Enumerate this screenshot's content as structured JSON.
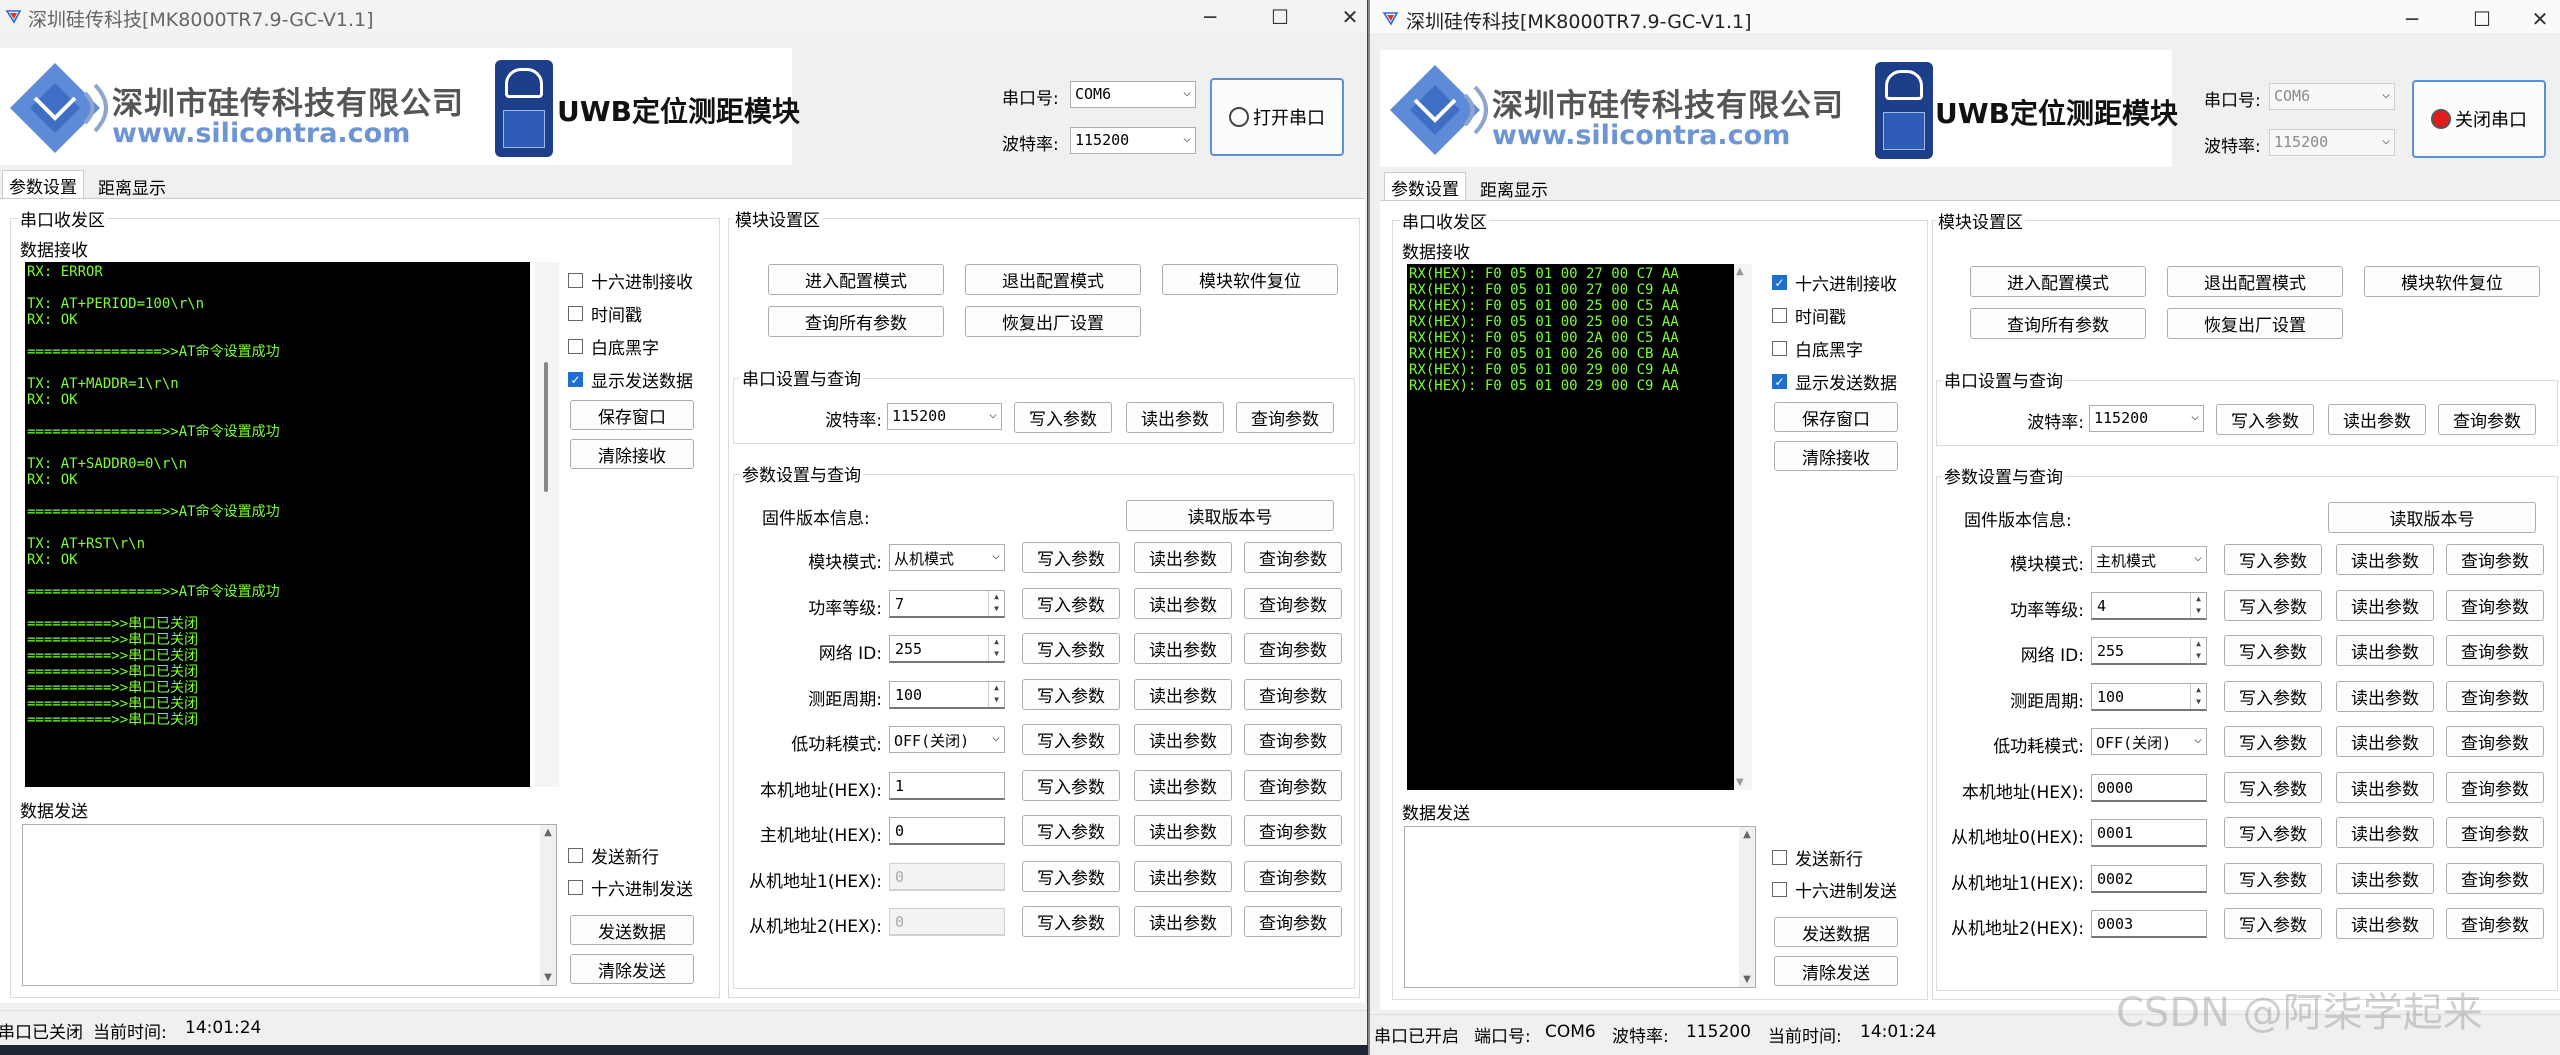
{
  "left": {
    "title": "深圳硅传科技[MK8000TR7.9-GC-V1.1]",
    "company": "深圳市硅传科技有限公司",
    "website": "www.silicontra.com",
    "product": "UWB定位测距模块",
    "port_label": "串口号:",
    "port_value": "COM6",
    "baud_label": "波特率:",
    "baud_value": "115200",
    "open_btn": "打开串口",
    "tabs": [
      "参数设置",
      "距离显示"
    ],
    "serial_group": "串口收发区",
    "recv_label": "数据接收",
    "term_lines": [
      "RX: ERROR",
      "",
      "TX: AT+PERIOD=100\\r\\n",
      "RX: OK",
      "",
      "================>>AT命令设置成功",
      "",
      "TX: AT+MADDR=1\\r\\n",
      "RX: OK",
      "",
      "================>>AT命令设置成功",
      "",
      "TX: AT+SADDR0=0\\r\\n",
      "RX: OK",
      "",
      "================>>AT命令设置成功",
      "",
      "TX: AT+RST\\r\\n",
      "RX: OK",
      "",
      "================>>AT命令设置成功",
      "",
      "==========>>串口已关闭",
      "==========>>串口已关闭",
      "==========>>串口已关闭",
      "==========>>串口已关闭",
      "==========>>串口已关闭",
      "==========>>串口已关闭",
      "==========>>串口已关闭"
    ],
    "chk_hex": "十六进制接收",
    "chk_time": "时间戳",
    "chk_white": "白底黑字",
    "chk_show": "显示发送数据",
    "save_btn": "保存窗口",
    "clear_recv_btn": "清除接收",
    "send_label": "数据发送",
    "chk_newline": "发送新行",
    "chk_hexsend": "十六进制发送",
    "send_btn": "发送数据",
    "clear_send_btn": "清除发送",
    "module_group": "模块设置区",
    "enter_cfg": "进入配置模式",
    "exit_cfg": "退出配置模式",
    "reset_btn": "模块软件复位",
    "query_all": "查询所有参数",
    "factory": "恢复出厂设置",
    "serial_cfg_group": "串口设置与查询",
    "baud2_label": "波特率:",
    "baud2_value": "115200",
    "write": "写入参数",
    "read": "读出参数",
    "query": "查询参数",
    "param_group": "参数设置与查询",
    "fw_label": "固件版本信息:",
    "read_ver": "读取版本号",
    "rows": [
      {
        "label": "模块模式:",
        "value": "从机模式",
        "type": "combo"
      },
      {
        "label": "功率等级:",
        "value": "7",
        "type": "spin"
      },
      {
        "label": "网络 ID:",
        "value": "255",
        "type": "spin"
      },
      {
        "label": "测距周期:",
        "value": "100",
        "type": "spin"
      },
      {
        "label": "低功耗模式:",
        "value": "OFF(关闭)",
        "type": "combo"
      },
      {
        "label": "本机地址(HEX):",
        "value": "1",
        "type": "input"
      },
      {
        "label": "主机地址(HEX):",
        "value": "0",
        "type": "input"
      },
      {
        "label": "从机地址1(HEX):",
        "value": "0",
        "type": "dis"
      },
      {
        "label": "从机地址2(HEX):",
        "value": "0",
        "type": "dis"
      }
    ],
    "status": "串口已关闭",
    "time_label": "当前时间:",
    "time_value": "14:01:24"
  },
  "right": {
    "title": "深圳硅传科技[MK8000TR7.9-GC-V1.1]",
    "company": "深圳市硅传科技有限公司",
    "website": "www.silicontra.com",
    "product": "UWB定位测距模块",
    "port_label": "串口号:",
    "port_value": "COM6",
    "baud_label": "波特率:",
    "baud_value": "115200",
    "close_btn": "关闭串口",
    "tabs": [
      "参数设置",
      "距离显示"
    ],
    "serial_group": "串口收发区",
    "recv_label": "数据接收",
    "term_lines": [
      "RX(HEX): F0 05 01 00 27 00 C7 AA",
      "RX(HEX): F0 05 01 00 27 00 C9 AA",
      "RX(HEX): F0 05 01 00 25 00 C5 AA",
      "RX(HEX): F0 05 01 00 25 00 C5 AA",
      "RX(HEX): F0 05 01 00 2A 00 C5 AA",
      "RX(HEX): F0 05 01 00 26 00 CB AA",
      "RX(HEX): F0 05 01 00 29 00 C9 AA",
      "RX(HEX): F0 05 01 00 29 00 C9 AA"
    ],
    "chk_hex": "十六进制接收",
    "chk_time": "时间戳",
    "chk_white": "白底黑字",
    "chk_show": "显示发送数据",
    "save_btn": "保存窗口",
    "clear_recv_btn": "清除接收",
    "send_label": "数据发送",
    "chk_newline": "发送新行",
    "chk_hexsend": "十六进制发送",
    "send_btn": "发送数据",
    "clear_send_btn": "清除发送",
    "module_group": "模块设置区",
    "enter_cfg": "进入配置模式",
    "exit_cfg": "退出配置模式",
    "reset_btn": "模块软件复位",
    "query_all": "查询所有参数",
    "factory": "恢复出厂设置",
    "serial_cfg_group": "串口设置与查询",
    "baud2_label": "波特率:",
    "baud2_value": "115200",
    "write": "写入参数",
    "read": "读出参数",
    "query": "查询参数",
    "param_group": "参数设置与查询",
    "fw_label": "固件版本信息:",
    "read_ver": "读取版本号",
    "rows": [
      {
        "label": "模块模式:",
        "value": "主机模式",
        "type": "combo"
      },
      {
        "label": "功率等级:",
        "value": "4",
        "type": "spin"
      },
      {
        "label": "网络 ID:",
        "value": "255",
        "type": "spin"
      },
      {
        "label": "测距周期:",
        "value": "100",
        "type": "spin"
      },
      {
        "label": "低功耗模式:",
        "value": "OFF(关闭)",
        "type": "combo"
      },
      {
        "label": "本机地址(HEX):",
        "value": "0000",
        "type": "input"
      },
      {
        "label": "从机地址0(HEX):",
        "value": "0001",
        "type": "input"
      },
      {
        "label": "从机地址1(HEX):",
        "value": "0002",
        "type": "input"
      },
      {
        "label": "从机地址2(HEX):",
        "value": "0003",
        "type": "input"
      }
    ],
    "status": "串口已开启",
    "port_status_label": "端口号:",
    "port_status_value": "COM6",
    "baud_status_label": "波特率:",
    "baud_status_value": "115200",
    "time_label": "当前时间:",
    "time_value": "14:01:24"
  },
  "watermark": "CSDN @阿柒学起来",
  "icons": {
    "minimize": "minimize-icon",
    "maximize": "maximize-icon",
    "close": "close-icon",
    "app": "app-icon"
  }
}
